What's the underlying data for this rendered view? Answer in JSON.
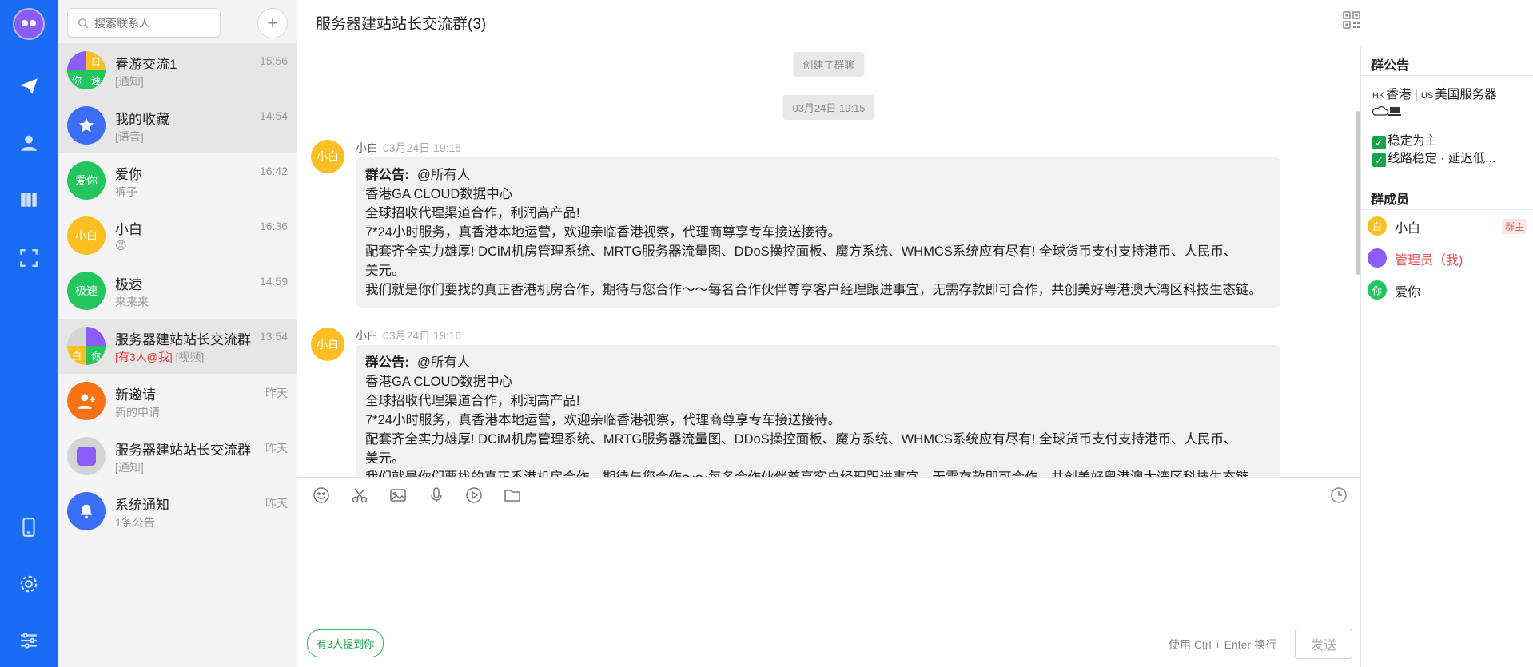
{
  "search": {
    "placeholder": "搜索联系人"
  },
  "conversations": [
    {
      "name": "春游交流1",
      "time": "15:56",
      "preview": "[通知]",
      "avatar_tiles": [
        "",
        "白",
        "你",
        "速"
      ]
    },
    {
      "name": "我的收藏",
      "time": "14:54",
      "preview": "[语音]"
    },
    {
      "name": "爱你",
      "time": "16:42",
      "preview": "裤子",
      "avatar": "爱你"
    },
    {
      "name": "小白",
      "time": "16:36",
      "preview": "😡",
      "avatar": "小白"
    },
    {
      "name": "极速",
      "time": "14:59",
      "preview": "来来来",
      "avatar": "极速"
    },
    {
      "name": "服务器建站站长交流群",
      "time": "13:54",
      "preview_mention": "[有3人@我]",
      "preview": "[视频]",
      "avatar_tiles": [
        "",
        "",
        "白",
        "你"
      ]
    },
    {
      "name": "新邀请",
      "time": "昨天",
      "preview": "新的申请"
    },
    {
      "name": "服务器建站站长交流群",
      "time": "昨天",
      "preview": "[通知]"
    },
    {
      "name": "系统通知",
      "time": "昨天",
      "preview": "1条公告"
    }
  ],
  "chat": {
    "title": "服务器建站站长交流群(3)",
    "system_created": "创建了群聊",
    "system_time": "03月24日 19:15",
    "messages": [
      {
        "sender": "小白",
        "time": "03月24日 19:15",
        "avatar": "小白",
        "label": "群公告:",
        "mention": "@所有人",
        "lines": [
          "香港GA CLOUD数据中心",
          "全球招收代理渠道合作，利润高产品!",
          "7*24小时服务，真香港本地运营，欢迎亲临香港视察，代理商尊享专车接送接待。",
          "配套齐全实力雄厚! DCiM机房管理系统、MRTG服务器流量图、DDoS操控面板、魔方系统、WHMCS系统应有尽有! 全球货币支付支持港币、人民币、",
          "美元。",
          "我们就是你们要找的真正香港机房合作，期待与您合作～～每名合作伙伴尊享客户经理跟进事宜，无需存款即可合作，共创美好粤港澳大湾区科技生态链。"
        ]
      },
      {
        "sender": "小白",
        "time": "03月24日 19:16",
        "avatar": "小白",
        "label": "群公告:",
        "mention": "@所有人",
        "lines": [
          "香港GA CLOUD数据中心",
          "全球招收代理渠道合作，利润高产品!",
          "7*24小时服务，真香港本地运营，欢迎亲临香港视察，代理商尊享专车接送接待。",
          "配套齐全实力雄厚! DCiM机房管理系统、MRTG服务器流量图、DDoS操控面板、魔方系统、WHMCS系统应有尽有! 全球货币支付支持港币、人民币、",
          "美元。",
          "我们就是你们要找的真正香港机房合作，期待与您合作～～每名合作伙伴尊享客户经理跟进事宜，无需存款即可合作，共创美好粤港澳大湾区科技生态链。"
        ]
      }
    ],
    "mention_chip": "有3人提到你",
    "send_hint": "使用 Ctrl + Enter 换行",
    "send_label": "发送"
  },
  "side": {
    "notice_title": "群公告",
    "notice_tag1": "HK",
    "notice_text1": "香港 | ",
    "notice_tag2": "US",
    "notice_text2": "美国服务器",
    "notice_item1": "稳定为主",
    "notice_item2": "线路稳定 · 延迟低...",
    "members_title": "群成员",
    "members": [
      {
        "name": "小白",
        "avatar": "白",
        "badge": "群主"
      },
      {
        "name": "管理员（我)",
        "avatar": ""
      },
      {
        "name": "爱你",
        "avatar": "你"
      }
    ]
  },
  "colors": {
    "rail": "#1a6cf5",
    "accent_green": "#22c55e",
    "mention_red": "#e53935"
  }
}
